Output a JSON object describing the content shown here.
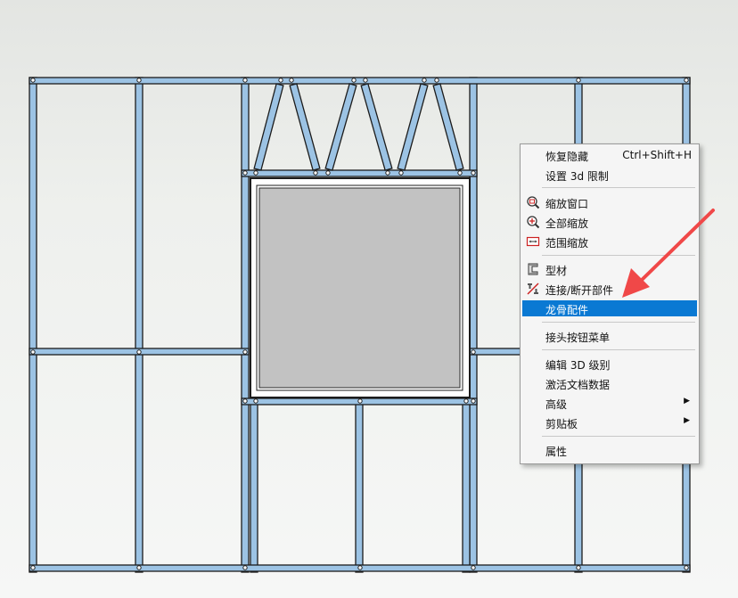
{
  "context_menu": {
    "items": [
      {
        "label": "恢复隐藏",
        "shortcut": "Ctrl+Shift+H"
      },
      {
        "label": "设置 3d 限制"
      },
      {
        "label": "缩放窗口",
        "icon": "zoom-window-icon"
      },
      {
        "label": "全部缩放",
        "icon": "zoom-all-icon"
      },
      {
        "label": "范围缩放",
        "icon": "zoom-extent-icon"
      },
      {
        "label": "型材",
        "icon": "profile-icon"
      },
      {
        "label": "连接/断开部件",
        "icon": "connect-disconnect-icon"
      },
      {
        "label": "龙骨配件",
        "selected": true
      },
      {
        "label": "接头按钮菜单"
      },
      {
        "label": "编辑 3D 级别"
      },
      {
        "label": "激活文档数据"
      },
      {
        "label": "高级",
        "submenu": true
      },
      {
        "label": "剪贴板",
        "submenu": true
      },
      {
        "label": "属性"
      }
    ]
  },
  "colors": {
    "stud_fill": "#9cc3e4",
    "stud_outline": "#1c1c1c",
    "window_glass": "#c2c2c2",
    "selection": "#0a79d3",
    "annotation_arrow": "#f04848"
  }
}
